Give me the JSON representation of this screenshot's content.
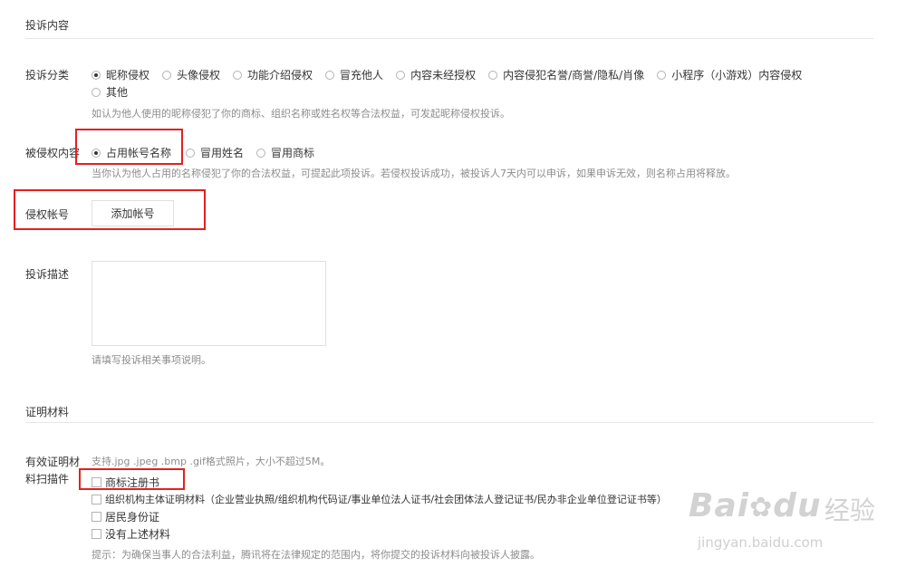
{
  "complaint_section": {
    "title": "投诉内容",
    "category": {
      "label": "投诉分类",
      "options": [
        "昵称侵权",
        "头像侵权",
        "功能介绍侵权",
        "冒充他人",
        "内容未经授权",
        "内容侵犯名誉/商誉/隐私/肖像",
        "小程序（小游戏）内容侵权",
        "其他"
      ],
      "selected": "昵称侵权",
      "hint": "如认为他人使用的昵称侵犯了你的商标、组织名称或姓名权等合法权益，可发起昵称侵权投诉。"
    },
    "infringed": {
      "label": "被侵权内容",
      "options": [
        "占用帐号名称",
        "冒用姓名",
        "冒用商标"
      ],
      "selected": "占用帐号名称",
      "hint": "当你认为他人占用的名称侵犯了你的合法权益，可提起此项投诉。若侵权投诉成功，被投诉人7天内可以申诉，如果申诉无效，则名称占用将释放。"
    },
    "account": {
      "label": "侵权帐号",
      "button": "添加帐号"
    },
    "description": {
      "label": "投诉描述",
      "hint": "请填写投诉相关事项说明。"
    }
  },
  "evidence_section": {
    "title": "证明材料",
    "label_line1": "有效证明材",
    "label_line2": "料扫描件",
    "format_hint": "支持.jpg .jpeg .bmp .gif格式照片，大小不超过5M。",
    "options": [
      "商标注册书",
      "组织机构主体证明材料（企业营业执照/组织机构代码证/事业单位法人证书/社会团体法人登记证书/民办非企业单位登记证书等）",
      "居民身份证",
      "没有上述材料"
    ],
    "notice": "提示：为确保当事人的合法利益，腾讯将在法律规定的范围内，将你提交的投诉材料向被投诉人披露。"
  },
  "watermark": {
    "brand": "Bai",
    "brand2": "du",
    "cn": "经验",
    "url": "jingyan.baidu.com"
  },
  "colors": {
    "highlight": "#e32020",
    "text": "#353535",
    "hint": "#8d8d8d",
    "border": "#e0e0e0"
  }
}
